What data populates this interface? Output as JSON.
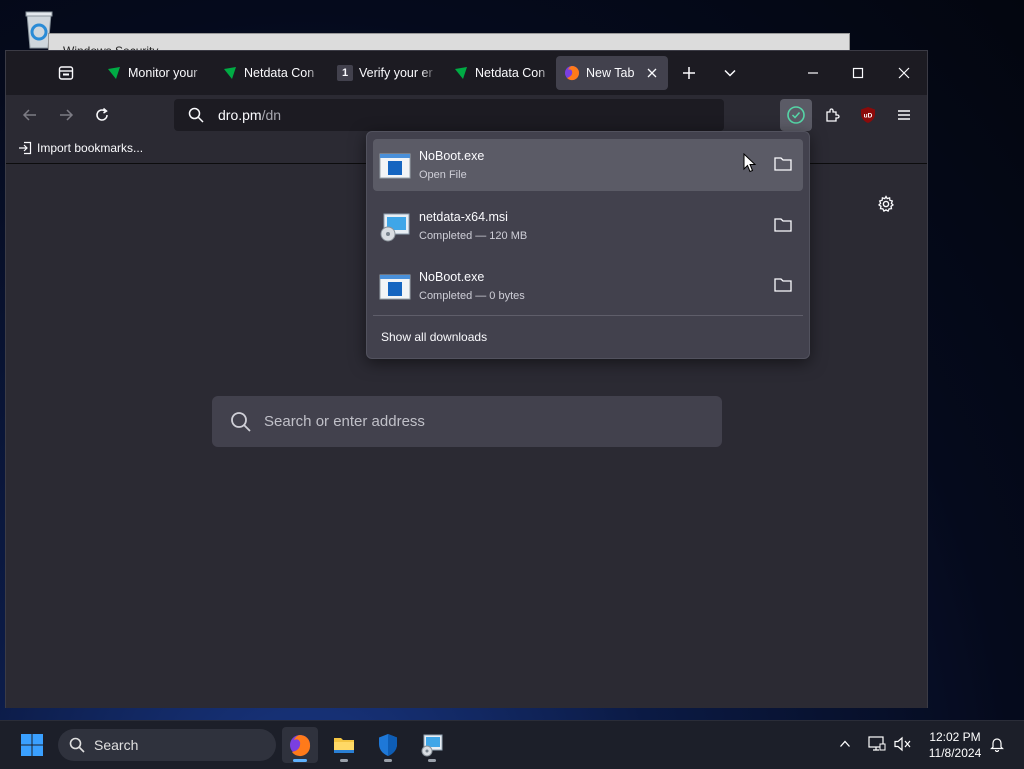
{
  "desktop": {
    "bg_window_title": "Windows Security"
  },
  "browser": {
    "tabs": [
      {
        "label": "Monitor your",
        "favicon": "netdata-leaf-icon"
      },
      {
        "label": "Netdata Con",
        "favicon": "netdata-leaf-icon"
      },
      {
        "label": "Verify your er",
        "favicon": "number-one-icon",
        "favicon_text": "1"
      },
      {
        "label": "Netdata Con",
        "favicon": "netdata-leaf-icon"
      },
      {
        "label": "New Tab",
        "favicon": "firefox-icon",
        "active": true
      }
    ],
    "url": {
      "host": "dro.pm",
      "path": "/dn"
    },
    "bookmarks": {
      "import_label": "Import bookmarks..."
    },
    "newtab": {
      "search_placeholder": "Search or enter address"
    },
    "extension_badge": "uD"
  },
  "downloads": {
    "items": [
      {
        "name": "NoBoot.exe",
        "status": "Open File",
        "icon": "exe-file-icon",
        "hover": true
      },
      {
        "name": "netdata-x64.msi",
        "status": "Completed — 120 MB",
        "icon": "msi-installer-icon"
      },
      {
        "name": "NoBoot.exe",
        "status": "Completed — 0 bytes",
        "icon": "exe-file-icon"
      }
    ],
    "show_all_label": "Show all downloads"
  },
  "taskbar": {
    "search_label": "Search",
    "time": "12:02 PM",
    "date": "11/8/2024"
  },
  "colors": {
    "accent": "#5fb2ff",
    "netdata_green": "#00ab44",
    "panel_bg": "#42414d",
    "toolbar_bg": "#2b2a33"
  }
}
